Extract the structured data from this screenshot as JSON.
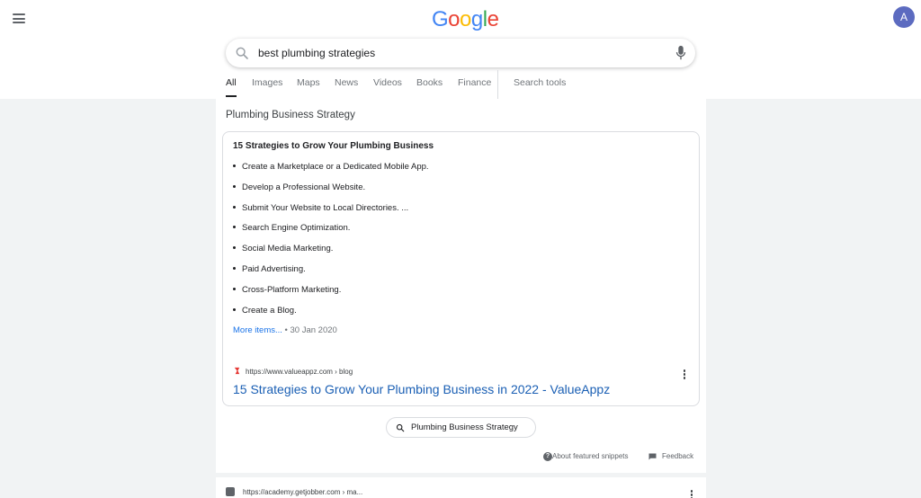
{
  "header": {
    "logo_letters": [
      "G",
      "o",
      "o",
      "g",
      "l",
      "e"
    ],
    "avatar_initial": "A"
  },
  "search": {
    "query": "best plumbing strategies"
  },
  "tabs": [
    {
      "label": "All",
      "active": true
    },
    {
      "label": "Images"
    },
    {
      "label": "Maps"
    },
    {
      "label": "News"
    },
    {
      "label": "Videos"
    },
    {
      "label": "Books"
    },
    {
      "label": "Finance"
    },
    {
      "label": "Search tools"
    }
  ],
  "featured": {
    "heading": "Plumbing Business Strategy",
    "title": "15 Strategies to Grow Your Plumbing Business",
    "items": [
      "Create a Marketplace or a Dedicated Mobile App.",
      "Develop a Professional Website.",
      "Submit Your Website to Local Directories. ...",
      "Search Engine Optimization.",
      "Social Media Marketing.",
      "Paid Advertising.",
      "Cross-Platform Marketing.",
      "Create a Blog."
    ],
    "more_label": "More items...",
    "date": " • 30 Jan 2020",
    "source_url": "https://www.valueappz.com › blog",
    "result_title": "15 Strategies to Grow Your Plumbing Business in 2022 - ValueAppz",
    "chip_label": "Plumbing Business Strategy",
    "about_label": "About featured snippets",
    "feedback_label": "Feedback"
  },
  "next_result": {
    "url": "https://academy.getjobber.com › ma..."
  },
  "colors": {
    "link": "#1a5fb4",
    "avatar": "#5c6bc0",
    "background": "#f1f3f4"
  }
}
